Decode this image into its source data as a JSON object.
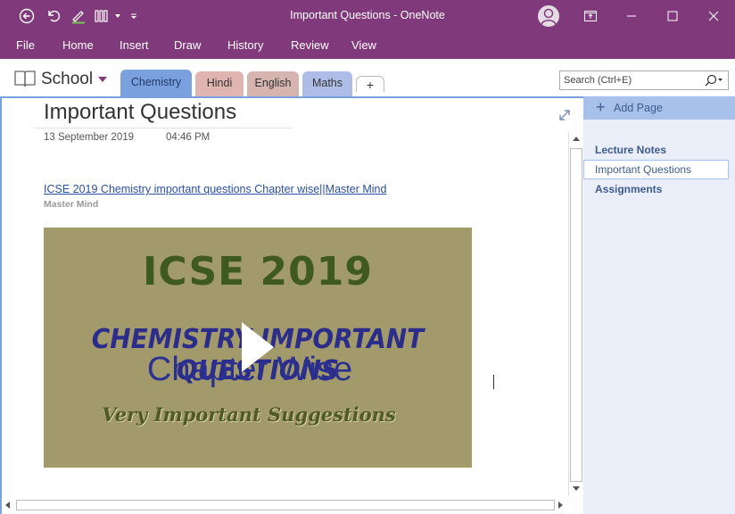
{
  "window": {
    "title": "Important Questions  -  OneNote"
  },
  "ribbon_tabs": [
    "File",
    "Home",
    "Insert",
    "Draw",
    "History",
    "Review",
    "View"
  ],
  "notebook": {
    "name": "School"
  },
  "sections": [
    {
      "label": "Chemistry",
      "color": "#7aa1de",
      "active": true
    },
    {
      "label": "Hindi",
      "color": "#e0b4b0"
    },
    {
      "label": "English",
      "color": "#d6b5b0"
    },
    {
      "label": "Maths",
      "color": "#aebde8"
    },
    {
      "label": "+",
      "color": "#ffffff"
    }
  ],
  "search": {
    "placeholder": "Search (Ctrl+E)"
  },
  "page": {
    "title": "Important Questions",
    "date": "13 September 2019",
    "time": "04:46 PM",
    "link_text": "ICSE 2019 Chemistry important questions Chapter wise||Master Mind",
    "source": "Master Mind",
    "video": {
      "line1": "ICSE 2019",
      "line2": "CHEMISTRY IMPORTANT QUESTIONS",
      "line3": "Chapter Wise",
      "line4": "Very Important Suggestions"
    }
  },
  "pages_pane": {
    "add_label": "Add Page",
    "items": [
      {
        "label": "Lecture Notes",
        "style": "bold"
      },
      {
        "label": "Important Questions",
        "style": "selected"
      },
      {
        "label": "Assignments",
        "style": "bold"
      }
    ]
  },
  "colors": {
    "titlebar": "#80397b",
    "accent": "#7aa1de"
  }
}
